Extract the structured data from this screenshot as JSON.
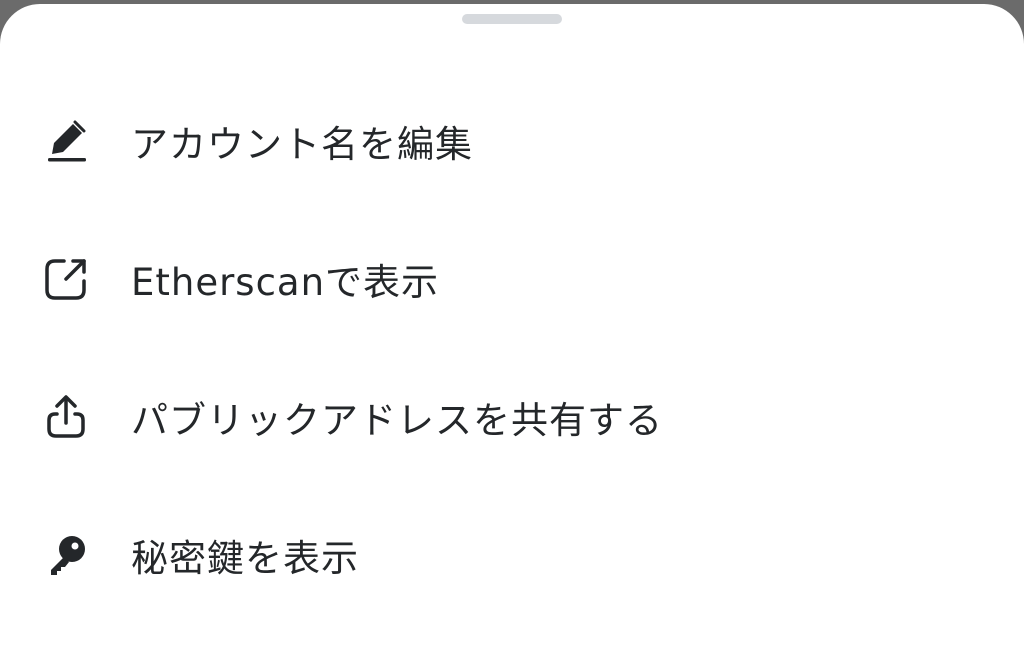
{
  "sheet": {
    "menu": [
      {
        "id": "edit",
        "label": "アカウント名を編集",
        "icon": "pencil-icon"
      },
      {
        "id": "etherscan",
        "label": "Etherscanで表示",
        "icon": "external-link-icon"
      },
      {
        "id": "share",
        "label": "パブリックアドレスを共有する",
        "icon": "share-icon"
      },
      {
        "id": "private-key",
        "label": "秘密鍵を表示",
        "icon": "key-icon"
      }
    ]
  },
  "colors": {
    "text": "#24272a",
    "icon": "#24272a",
    "handle": "#d6d9dd",
    "background": "#ffffff"
  }
}
